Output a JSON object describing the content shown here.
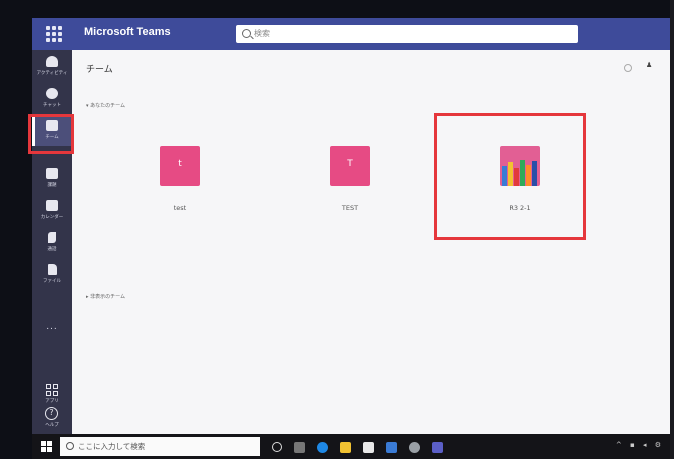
{
  "app": {
    "title": "Microsoft Teams",
    "search_placeholder": "検索"
  },
  "rail": {
    "items": [
      {
        "label": "アクティビティ",
        "icon": "bell-icon"
      },
      {
        "label": "チャット",
        "icon": "chat-icon"
      },
      {
        "label": "チーム",
        "icon": "teams-icon"
      },
      {
        "label": "課題",
        "icon": "assignments-icon"
      },
      {
        "label": "カレンダー",
        "icon": "calendar-icon"
      },
      {
        "label": "通話",
        "icon": "phone-icon"
      },
      {
        "label": "ファイル",
        "icon": "file-icon"
      }
    ],
    "more": "...",
    "apps_label": "アプリ",
    "help_label": "ヘルプ"
  },
  "main": {
    "title": "チーム",
    "section_your_teams": "あなたのチーム",
    "section_hidden_teams": "非表示のチーム",
    "teams": [
      {
        "initial": "t",
        "name": "test",
        "color": "#e64b84"
      },
      {
        "initial": "T",
        "name": "TEST",
        "color": "#e64b84"
      },
      {
        "initial": "",
        "name": "R3 2-1",
        "color": "#e25f94"
      }
    ]
  },
  "taskbar": {
    "search_text": "ここに入力して検索"
  },
  "colors": {
    "titlebar": "#3e4b9a",
    "rail": "#33344a",
    "highlight": "#e5373c"
  }
}
